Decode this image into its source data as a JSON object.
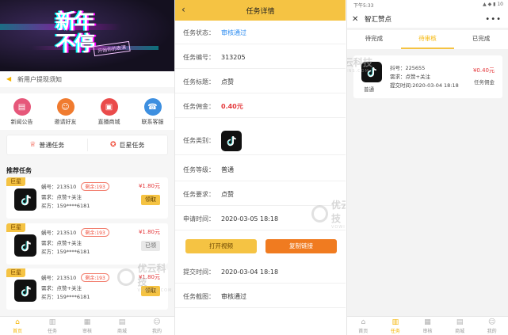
{
  "panel1": {
    "banner": {
      "title": "新年不停",
      "subtitle": "开始你的表演"
    },
    "notice": "新用户提现须知",
    "quick": [
      {
        "label": "新闻公告",
        "color": "#e6577a",
        "icon": "news-icon"
      },
      {
        "label": "邀请好友",
        "color": "#f07b2f",
        "icon": "invite-icon"
      },
      {
        "label": "直播商城",
        "color": "#ea4b4b",
        "icon": "shop-icon"
      },
      {
        "label": "联系客服",
        "color": "#3d8fe0",
        "icon": "service-icon"
      }
    ],
    "task_types": [
      {
        "label": "普通任务"
      },
      {
        "label": "巨星任务"
      }
    ],
    "recommend_title": "推荐任务",
    "cards": [
      {
        "tag": "巨星",
        "id_line": "蜗号：213510",
        "remain": "剩余:193",
        "need": "需求：点赞+关注",
        "buyer": "买方：159****6181",
        "price": "¥1.80元",
        "button": "领取",
        "done": false
      },
      {
        "tag": "巨星",
        "id_line": "蜗号：213510",
        "remain": "剩余:193",
        "need": "需求：点赞+关注",
        "buyer": "买方：159****6181",
        "price": "¥1.80元",
        "button": "已领",
        "done": true
      },
      {
        "tag": "巨星",
        "id_line": "蜗号：213510",
        "remain": "剩余:193",
        "need": "需求：点赞+关注",
        "buyer": "买方：159****6181",
        "price": "¥1.80元",
        "button": "领取",
        "done": false
      }
    ],
    "tabbar": [
      {
        "label": "首页",
        "icon": "home-icon",
        "active": true
      },
      {
        "label": "任务",
        "icon": "task-icon",
        "active": false
      },
      {
        "label": "审核",
        "icon": "review-icon",
        "active": false
      },
      {
        "label": "商城",
        "icon": "store-icon",
        "active": false
      },
      {
        "label": "我的",
        "icon": "profile-icon",
        "active": false
      }
    ]
  },
  "panel2": {
    "title": "任务详情",
    "rows": [
      {
        "key": "任务状态：",
        "value": "审核通过"
      },
      {
        "key": "任务编号：",
        "value": "313205"
      },
      {
        "key": "任务标题：",
        "value": "点赞"
      },
      {
        "key": "任务佣金：",
        "value": "0.40元"
      },
      {
        "key": "任务类别：",
        "value": ""
      },
      {
        "key": "任务等级：",
        "value": "普通"
      },
      {
        "key": "任务要求：",
        "value": "点赞"
      },
      {
        "key": "申请时间：",
        "value": "2020-03-05 18:18"
      },
      {
        "key": "提交时间：",
        "value": "2020-03-04 18:18"
      },
      {
        "key": "任务截图：",
        "value": "审核通过"
      }
    ],
    "open_button": "打开视频",
    "copy_button": "复制链接"
  },
  "panel3": {
    "status_time": "下午5:33",
    "status_icons": "▲ ◆ ▮ 10",
    "title": "智汇赞点",
    "tabs": [
      {
        "label": "待完成"
      },
      {
        "label": "待审核",
        "active": true
      },
      {
        "label": "已完成"
      }
    ],
    "card": {
      "level": "普通",
      "id_line": "抖号：225655",
      "need": "需求：点赞+关注",
      "submit": "提交时间:2020-03-04 18:18",
      "price": "¥0.40元",
      "price_label": "任务佣金"
    },
    "tabbar": [
      {
        "label": "首页",
        "active": false
      },
      {
        "label": "任务",
        "active": true
      },
      {
        "label": "审核",
        "active": false
      },
      {
        "label": "商城",
        "active": false
      },
      {
        "label": "我的",
        "active": false
      }
    ]
  },
  "watermark": {
    "cn": "优云科技",
    "en": "VOWINS.COM"
  },
  "colors": {
    "accent": "#f5c343",
    "price": "#e4393c",
    "blue": "#2d8cf0",
    "orange": "#f07b20"
  }
}
